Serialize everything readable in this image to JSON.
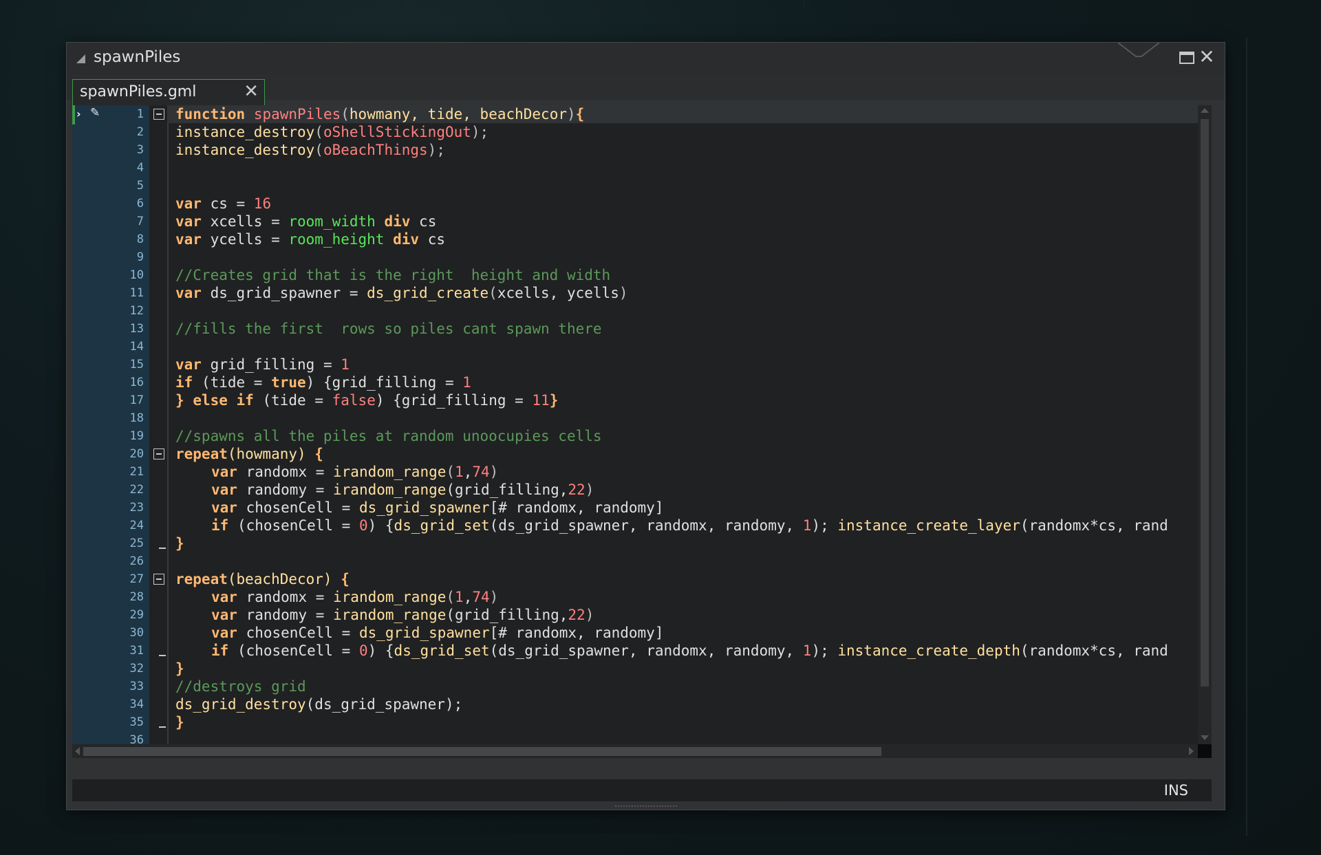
{
  "window": {
    "title": "spawnPiles",
    "tab_label": "spawnPiles.gml"
  },
  "statusbar": {
    "mode": "INS"
  },
  "line_numbers": [
    "1",
    "2",
    "3",
    "4",
    "5",
    "6",
    "7",
    "8",
    "9",
    "10",
    "11",
    "12",
    "13",
    "14",
    "15",
    "16",
    "17",
    "18",
    "19",
    "20",
    "21",
    "22",
    "23",
    "24",
    "25",
    "26",
    "27",
    "28",
    "29",
    "30",
    "31",
    "32",
    "33",
    "34",
    "35",
    "36"
  ],
  "code": {
    "l1": {
      "t1": "function",
      "t2": " ",
      "t3": "spawnPiles",
      "t4": "(",
      "t5": "howmany, tide, beachDecor",
      "t6": ")",
      "t7": "{"
    },
    "l2": {
      "t1": "instance_destroy",
      "t2": "(",
      "t3": "oShellStickingOut",
      "t4": ");"
    },
    "l3": {
      "t1": "instance_destroy",
      "t2": "(",
      "t3": "oBeachThings",
      "t4": ");"
    },
    "l6": {
      "t1": "var",
      "t2": " cs = ",
      "t3": "16"
    },
    "l7": {
      "t1": "var",
      "t2": " xcells = ",
      "t3": "room_width",
      "t4": " ",
      "t5": "div",
      "t6": " cs"
    },
    "l8": {
      "t1": "var",
      "t2": " ycells = ",
      "t3": "room_height",
      "t4": " ",
      "t5": "div",
      "t6": " cs"
    },
    "l10": {
      "t1": "//Creates grid that is the right  height and width"
    },
    "l11": {
      "t1": "var",
      "t2": " ds_grid_spawner = ",
      "t3": "ds_grid_create",
      "t4": "(",
      "t5": "xcells, ycells",
      "t6": ")"
    },
    "l13": {
      "t1": "//fills the first  rows so piles cant spawn there"
    },
    "l15": {
      "t1": "var",
      "t2": " grid_filling = ",
      "t3": "1"
    },
    "l16": {
      "t1": "if",
      "t2": " (tide = ",
      "t3": "true",
      "t4": ") {grid_filling = ",
      "t5": "1"
    },
    "l17": {
      "t1": "}",
      "t2": " ",
      "t3": "else if",
      "t4": " (tide = ",
      "t5": "false",
      "t6": ") {grid_filling = ",
      "t7": "11",
      "t8": "}"
    },
    "l19": {
      "t1": "//spawns all the piles at random unoocupies cells"
    },
    "l20": {
      "t1": "repeat",
      "t2": "(howmany) ",
      "t3": "{"
    },
    "l21": {
      "t1": "var",
      "t2": " randomx = ",
      "t3": "irandom_range",
      "t4": "(",
      "t5": "1",
      "t6": ",",
      "t7": "74",
      "t8": ")"
    },
    "l22": {
      "t1": "var",
      "t2": " randomy = ",
      "t3": "irandom_range",
      "t4": "(grid_filling,",
      "t5": "22",
      "t6": ")"
    },
    "l23": {
      "t1": "var",
      "t2": " chosenCell = ",
      "t3": "ds_grid_spawner",
      "t4": "[# randomx, randomy]"
    },
    "l24": {
      "t1": "if",
      "t2": " (chosenCell = ",
      "t3": "0",
      "t4": ") {",
      "t5": "ds_grid_set",
      "t6": "(ds_grid_spawner, randomx, randomy, ",
      "t7": "1",
      "t8": "); ",
      "t9": "instance_create_layer",
      "t10": "(randomx*cs, rand"
    },
    "l25": {
      "t1": "}"
    },
    "l27": {
      "t1": "repeat",
      "t2": "(beachDecor) ",
      "t3": "{"
    },
    "l28": {
      "t1": "var",
      "t2": " randomx = ",
      "t3": "irandom_range",
      "t4": "(",
      "t5": "1",
      "t6": ",",
      "t7": "74",
      "t8": ")"
    },
    "l29": {
      "t1": "var",
      "t2": " randomy = ",
      "t3": "irandom_range",
      "t4": "(grid_filling,",
      "t5": "22",
      "t6": ")"
    },
    "l30": {
      "t1": "var",
      "t2": " chosenCell = ",
      "t3": "ds_grid_spawner",
      "t4": "[# randomx, randomy]"
    },
    "l31": {
      "t1": "if",
      "t2": " (chosenCell = ",
      "t3": "0",
      "t4": ") {",
      "t5": "ds_grid_set",
      "t6": "(ds_grid_spawner, randomx, randomy, ",
      "t7": "1",
      "t8": "); ",
      "t9": "instance_create_depth",
      "t10": "(randomx*cs, rand"
    },
    "l32": {
      "t1": "}"
    },
    "l33": {
      "t1": "//destroys grid"
    },
    "l34": {
      "t1": "ds_grid_destroy",
      "t2": "(ds_grid_spawner);"
    },
    "l35": {
      "t1": "}"
    }
  },
  "colors": {
    "keyword": "#ffb871",
    "function": "#ffe0a0",
    "object": "#ff8080",
    "number": "#ff8080",
    "comment": "#5b995b",
    "builtin": "#58e55a",
    "tab_accent": "#3b9b4a",
    "gutter": "#1c3444"
  },
  "icons": {
    "collapse": "triangle-collapse-icon",
    "maximize": "maximize-icon",
    "close": "close-icon",
    "tab_close": "close-icon",
    "fold": "fold-minus-icon"
  }
}
